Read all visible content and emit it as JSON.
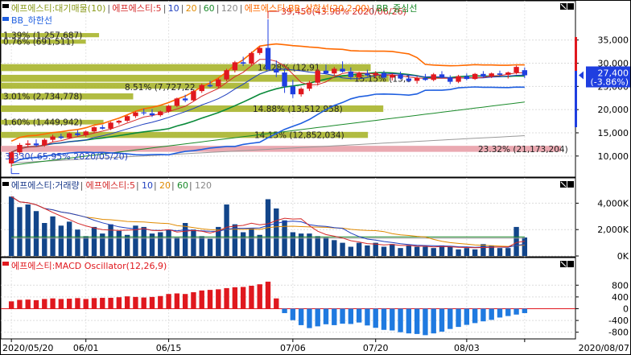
{
  "title_price": "에프에스티:대기매물(10)",
  "legend_price": [
    {
      "text": "에프에스티:대기매물(10)",
      "color": "#8a9a1a"
    },
    {
      "text": "에프에스티:5",
      "color": "#d42a2a"
    },
    {
      "text": "10",
      "color": "#1f3fbf"
    },
    {
      "text": "20",
      "color": "#e08a00"
    },
    {
      "text": "60",
      "color": "#1a8a2a"
    },
    {
      "text": "120",
      "color": "#888888"
    },
    {
      "text": "에프에스티:BB_상한선(20,2.00)",
      "color": "#ff6a00"
    },
    {
      "text": "BB_중심선",
      "color": "#1a8a2a"
    }
  ],
  "legend_price2": "BB_하한선",
  "legend_volume": [
    {
      "text": "에프에스티:거래량",
      "color": "#1a3a8a"
    },
    {
      "text": "에프에스티:5",
      "color": "#d42a2a"
    },
    {
      "text": "10",
      "color": "#1f3fbf"
    },
    {
      "text": "20",
      "color": "#e08a00"
    },
    {
      "text": "60",
      "color": "#1a8a2a"
    },
    {
      "text": "120",
      "color": "#888888"
    }
  ],
  "legend_macd": "에프에스티:MACD Oscillator(12,26,9)",
  "current_price": "27,400",
  "current_change": "(-3.86%)",
  "annotations": {
    "high": "39,450(43.98% 2020/06/26)",
    "low": "3,330(-65.95% 2020/05/20)"
  },
  "supply_labels": [
    "1.39% (1,257,687)",
    "0.76% (691,511)",
    "14.28% (12,91",
    "8.51% (7,727,22",
    "15.15% (13,1",
    "3.01% (2,734,778)",
    "14.88% (13,512,958)",
    "1.60% (1,449,942)",
    "14.15% (12,852,034)",
    "23.32% (21,173,204)"
  ],
  "chart_data": {
    "type": "candlestick",
    "x_tick_labels": [
      "2020/05/20",
      "06/01",
      "06/15",
      "07/06",
      "07/20",
      "08/03",
      "2020/08/07"
    ],
    "price_axis": {
      "ticks": [
        "35,000",
        "30,000",
        "25,000",
        "20,000",
        "15,000",
        "10,000"
      ],
      "values": [
        35000,
        30000,
        25000,
        20000,
        15000,
        10000
      ],
      "ylim": [
        6500,
        40500
      ]
    },
    "volume_axis": {
      "ticks": [
        "4,000K",
        "2,000K",
        "0K"
      ],
      "values": [
        4000,
        2000,
        0
      ],
      "ylim": [
        0,
        5000
      ]
    },
    "macd_axis": {
      "ticks": [
        "800",
        "400",
        "0",
        "-400",
        "-800"
      ],
      "values": [
        800,
        400,
        0,
        -400,
        -800
      ],
      "ylim": [
        -1000,
        1300
      ]
    },
    "supply_zones": [
      {
        "low": 35600,
        "high": 36500,
        "pct": 1.39,
        "vol": 1257687
      },
      {
        "low": 34200,
        "high": 35100,
        "pct": 0.76,
        "vol": 691511
      },
      {
        "low": 28300,
        "high": 29800,
        "pct": 14.28,
        "vol": 12910000
      },
      {
        "low": 26000,
        "high": 27500,
        "pct": 15.15,
        "vol": 13100000
      },
      {
        "low": 24500,
        "high": 25800,
        "pct": 8.51,
        "vol": 7727220
      },
      {
        "low": 22200,
        "high": 23500,
        "pct": 3.01,
        "vol": 2734778
      },
      {
        "low": 19500,
        "high": 20900,
        "pct": 14.88,
        "vol": 13512958
      },
      {
        "low": 16800,
        "high": 17800,
        "pct": 1.6,
        "vol": 1449942
      },
      {
        "low": 13900,
        "high": 15200,
        "pct": 14.15,
        "vol": 12852034
      },
      {
        "low": 10900,
        "high": 12200,
        "pct": 23.32,
        "vol": 21173204
      }
    ],
    "candles": [
      {
        "o": 8400,
        "h": 11000,
        "l": 7600,
        "c": 10800
      },
      {
        "o": 10800,
        "h": 12800,
        "l": 10200,
        "c": 12400
      },
      {
        "o": 12400,
        "h": 13400,
        "l": 11800,
        "c": 12700
      },
      {
        "o": 12700,
        "h": 13600,
        "l": 12000,
        "c": 12300
      },
      {
        "o": 12300,
        "h": 13800,
        "l": 12000,
        "c": 13500
      },
      {
        "o": 13500,
        "h": 14600,
        "l": 13000,
        "c": 14200
      },
      {
        "o": 14200,
        "h": 14800,
        "l": 13600,
        "c": 13900
      },
      {
        "o": 13900,
        "h": 15100,
        "l": 13700,
        "c": 14900
      },
      {
        "o": 14900,
        "h": 15600,
        "l": 14300,
        "c": 14500
      },
      {
        "o": 14500,
        "h": 15500,
        "l": 14100,
        "c": 15300
      },
      {
        "o": 15300,
        "h": 16400,
        "l": 15000,
        "c": 16200
      },
      {
        "o": 16200,
        "h": 16700,
        "l": 15700,
        "c": 15900
      },
      {
        "o": 15900,
        "h": 17400,
        "l": 15600,
        "c": 17200
      },
      {
        "o": 17200,
        "h": 17800,
        "l": 16800,
        "c": 17600
      },
      {
        "o": 17600,
        "h": 18800,
        "l": 17300,
        "c": 18600
      },
      {
        "o": 18600,
        "h": 19600,
        "l": 18200,
        "c": 19400
      },
      {
        "o": 19400,
        "h": 20200,
        "l": 18800,
        "c": 19200
      },
      {
        "o": 19200,
        "h": 20100,
        "l": 18400,
        "c": 18800
      },
      {
        "o": 18800,
        "h": 19800,
        "l": 18500,
        "c": 19600
      },
      {
        "o": 19600,
        "h": 21000,
        "l": 19300,
        "c": 20800
      },
      {
        "o": 20800,
        "h": 22600,
        "l": 20500,
        "c": 22400
      },
      {
        "o": 22400,
        "h": 23200,
        "l": 21600,
        "c": 22000
      },
      {
        "o": 22000,
        "h": 24200,
        "l": 21800,
        "c": 24000
      },
      {
        "o": 24000,
        "h": 25600,
        "l": 23600,
        "c": 25300
      },
      {
        "o": 25300,
        "h": 26200,
        "l": 24800,
        "c": 25000
      },
      {
        "o": 25000,
        "h": 26800,
        "l": 24700,
        "c": 26500
      },
      {
        "o": 26500,
        "h": 28800,
        "l": 26100,
        "c": 28500
      },
      {
        "o": 28500,
        "h": 30500,
        "l": 28000,
        "c": 30200
      },
      {
        "o": 30200,
        "h": 31400,
        "l": 29400,
        "c": 29900
      },
      {
        "o": 29900,
        "h": 32500,
        "l": 29600,
        "c": 32200
      },
      {
        "o": 32200,
        "h": 33600,
        "l": 31800,
        "c": 33300
      },
      {
        "o": 33300,
        "h": 39450,
        "l": 32500,
        "c": 28600
      },
      {
        "o": 28600,
        "h": 30600,
        "l": 27000,
        "c": 28000
      },
      {
        "o": 28000,
        "h": 28800,
        "l": 23600,
        "c": 25000
      },
      {
        "o": 25000,
        "h": 26400,
        "l": 22500,
        "c": 23300
      },
      {
        "o": 23300,
        "h": 24800,
        "l": 22800,
        "c": 24500
      },
      {
        "o": 24500,
        "h": 26200,
        "l": 24000,
        "c": 25800
      },
      {
        "o": 25800,
        "h": 28800,
        "l": 25200,
        "c": 28400
      },
      {
        "o": 28400,
        "h": 29700,
        "l": 27600,
        "c": 27800
      },
      {
        "o": 27800,
        "h": 29200,
        "l": 27300,
        "c": 28800
      },
      {
        "o": 28800,
        "h": 30400,
        "l": 28000,
        "c": 28200
      },
      {
        "o": 28200,
        "h": 29100,
        "l": 26500,
        "c": 27000
      },
      {
        "o": 27000,
        "h": 28200,
        "l": 26400,
        "c": 27800
      },
      {
        "o": 27800,
        "h": 28600,
        "l": 27100,
        "c": 27400
      },
      {
        "o": 27400,
        "h": 28300,
        "l": 26800,
        "c": 27900
      },
      {
        "o": 27900,
        "h": 28400,
        "l": 26700,
        "c": 26900
      },
      {
        "o": 26900,
        "h": 27800,
        "l": 26300,
        "c": 27500
      },
      {
        "o": 27500,
        "h": 28200,
        "l": 26500,
        "c": 26700
      },
      {
        "o": 26700,
        "h": 27600,
        "l": 25900,
        "c": 26200
      },
      {
        "o": 26200,
        "h": 27200,
        "l": 25600,
        "c": 26800
      },
      {
        "o": 26800,
        "h": 27700,
        "l": 26200,
        "c": 26400
      },
      {
        "o": 26400,
        "h": 27900,
        "l": 26100,
        "c": 27600
      },
      {
        "o": 27600,
        "h": 28300,
        "l": 26700,
        "c": 26900
      },
      {
        "o": 26900,
        "h": 27400,
        "l": 25500,
        "c": 26000
      },
      {
        "o": 26000,
        "h": 27500,
        "l": 25700,
        "c": 27200
      },
      {
        "o": 27200,
        "h": 27800,
        "l": 26300,
        "c": 26600
      },
      {
        "o": 26600,
        "h": 27900,
        "l": 26400,
        "c": 27700
      },
      {
        "o": 27700,
        "h": 28300,
        "l": 26900,
        "c": 27100
      },
      {
        "o": 27100,
        "h": 28000,
        "l": 26800,
        "c": 27800
      },
      {
        "o": 27800,
        "h": 28400,
        "l": 27200,
        "c": 27500
      },
      {
        "o": 27500,
        "h": 28200,
        "l": 26700,
        "c": 28000
      },
      {
        "o": 28000,
        "h": 29500,
        "l": 27600,
        "c": 29200
      },
      {
        "o": 28500,
        "h": 29100,
        "l": 26800,
        "c": 27400
      }
    ],
    "volume": [
      4500,
      3700,
      3900,
      3400,
      2500,
      3000,
      2300,
      2600,
      2000,
      1500,
      2200,
      1700,
      2400,
      1900,
      1600,
      2300,
      2200,
      1700,
      1800,
      2000,
      1400,
      2500,
      2000,
      1500,
      1300,
      2200,
      3900,
      2400,
      1800,
      2100,
      1600,
      4300,
      3600,
      2700,
      1800,
      1700,
      1700,
      1500,
      1400,
      1200,
      1000,
      700,
      1000,
      800,
      1000,
      700,
      900,
      600,
      800,
      700,
      700,
      600,
      800,
      700,
      500,
      600,
      500,
      900,
      800,
      600,
      600,
      2200,
      1400
    ],
    "macd": [
      250,
      300,
      310,
      290,
      330,
      350,
      330,
      340,
      360,
      330,
      360,
      370,
      370,
      390,
      420,
      400,
      380,
      400,
      430,
      500,
      520,
      500,
      560,
      620,
      640,
      660,
      700,
      730,
      740,
      780,
      830,
      920,
      350,
      -150,
      -390,
      -560,
      -660,
      -600,
      -530,
      -560,
      -510,
      -520,
      -470,
      -570,
      -650,
      -720,
      -740,
      -800,
      -840,
      -860,
      -900,
      -840,
      -780,
      -690,
      -620,
      -550,
      -490,
      -430,
      -380,
      -300,
      -250,
      -200,
      -150
    ]
  }
}
